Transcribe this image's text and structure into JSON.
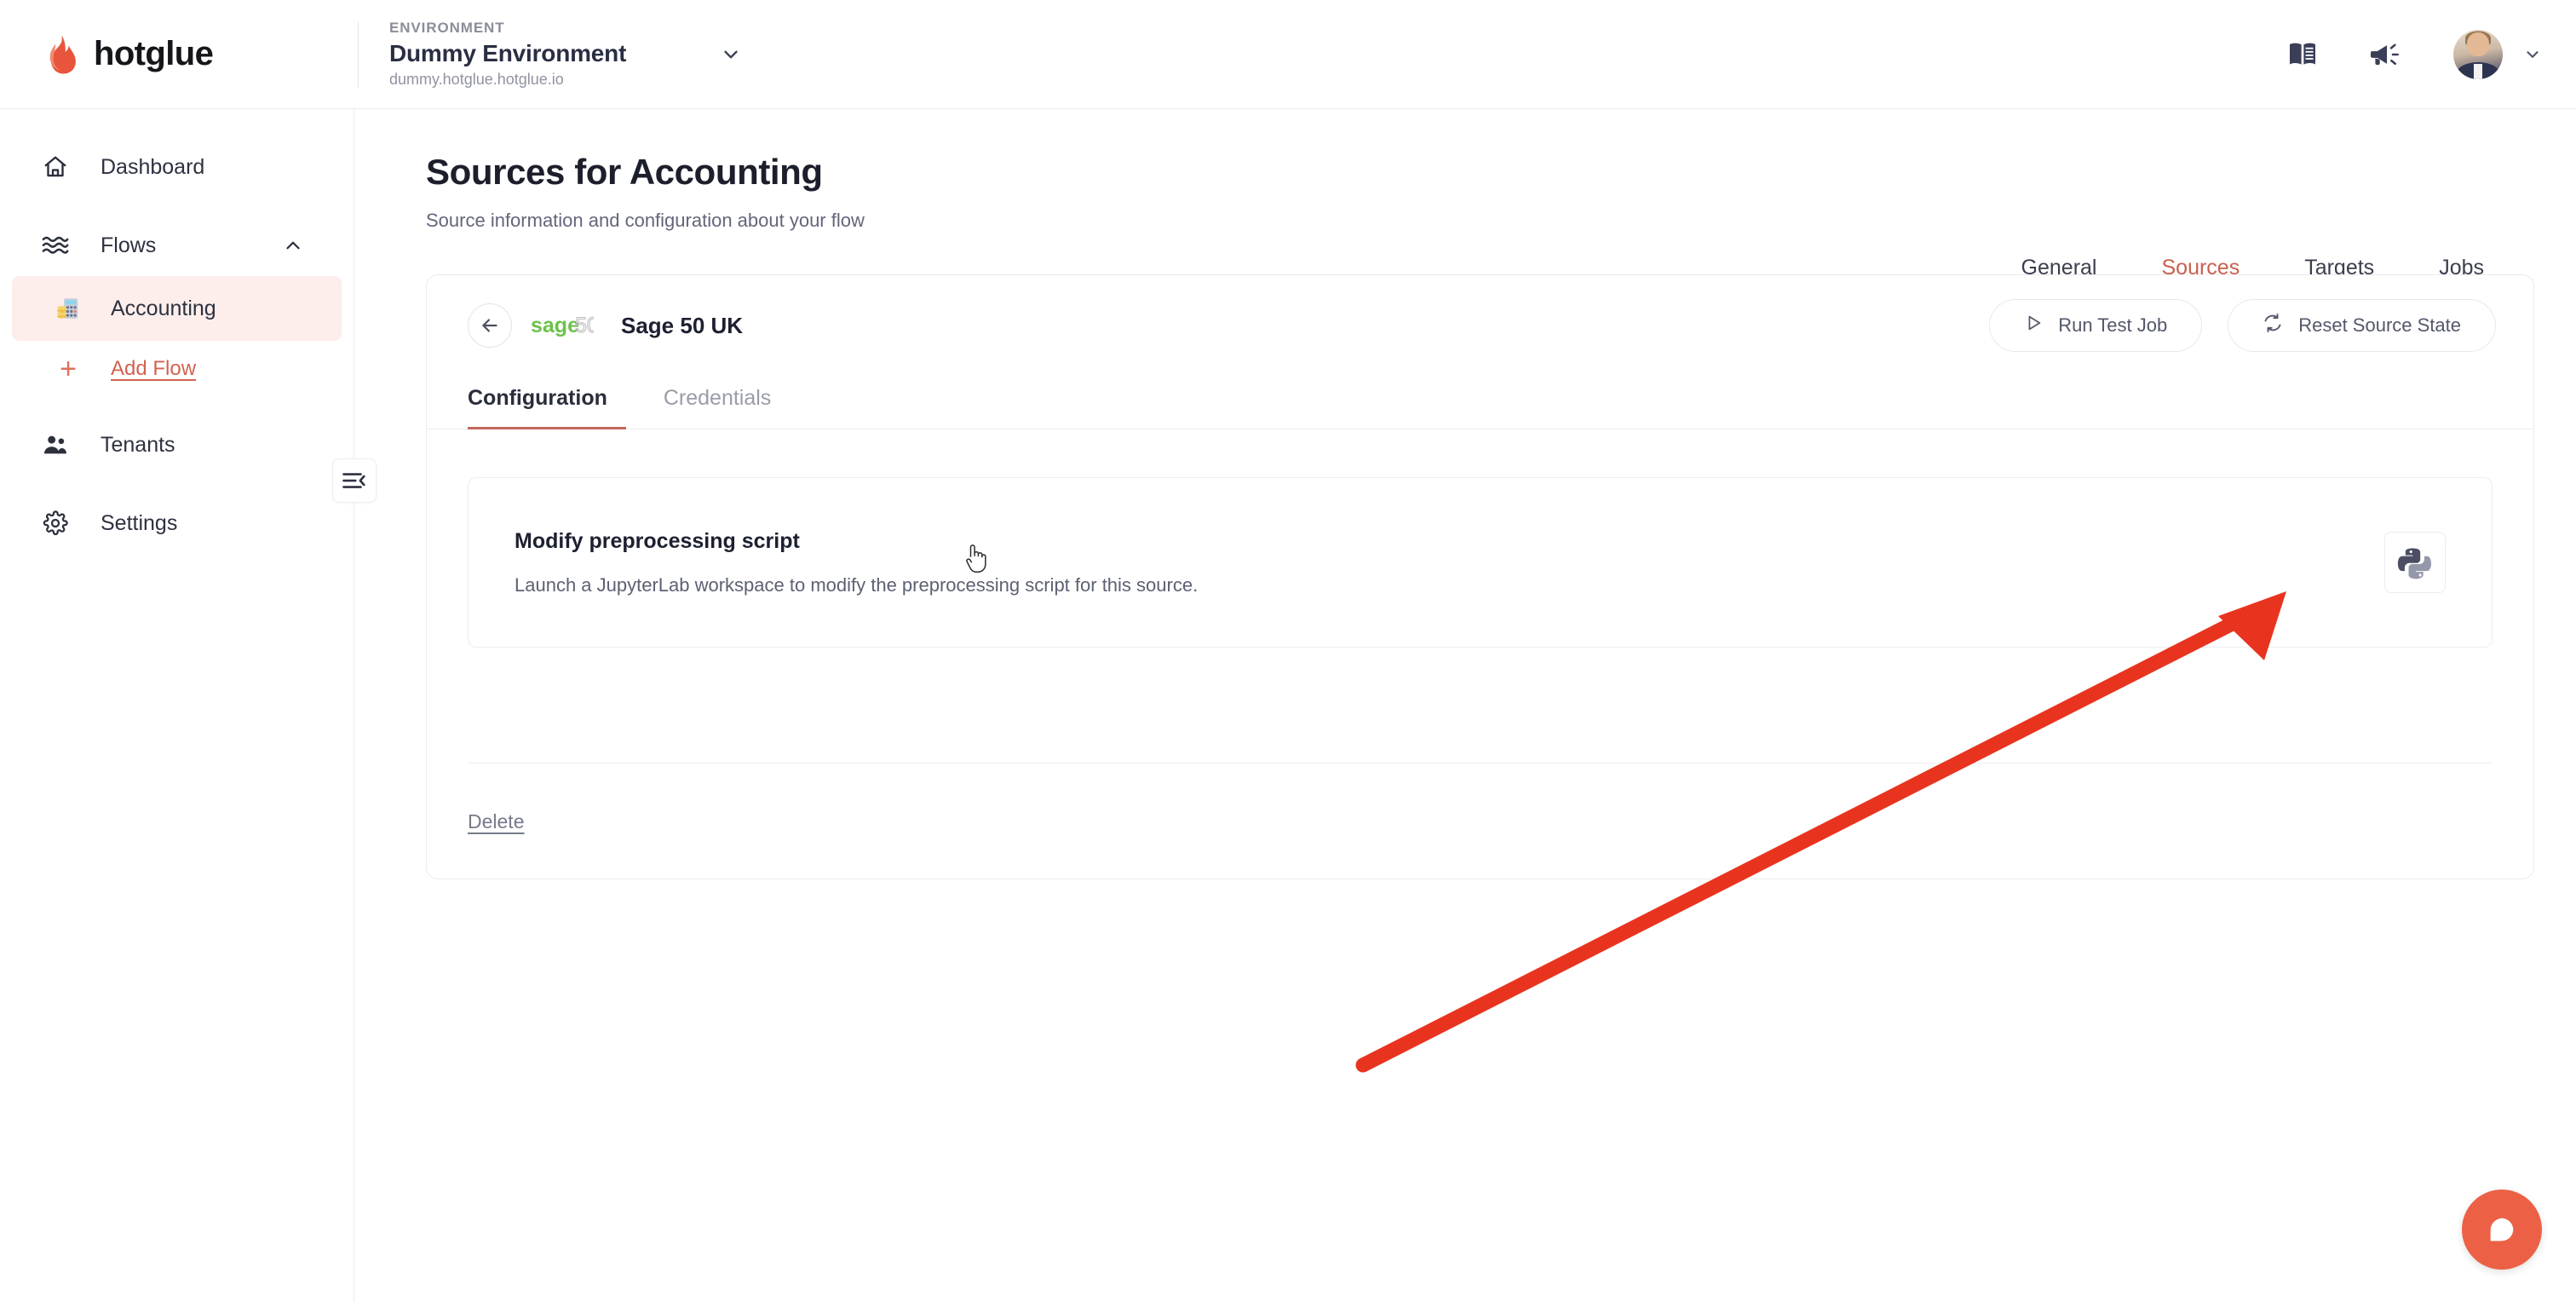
{
  "topbar": {
    "brand_name": "hotglue",
    "logo_icon": "flame-icon",
    "environment": {
      "label": "ENVIRONMENT",
      "name": "Dummy Environment",
      "url": "dummy.hotglue.hotglue.io",
      "caret_icon": "chevron-down-icon"
    },
    "docs_icon": "book-icon",
    "announcements_icon": "megaphone-icon",
    "avatar_icon": "user-avatar",
    "user_caret_icon": "chevron-down-icon"
  },
  "sidebar": {
    "collapse_icon": "collapse-sidebar-icon",
    "items": [
      {
        "label": "Dashboard",
        "icon": "home-icon"
      },
      {
        "label": "Flows",
        "icon": "flows-icon",
        "chevron": "chevron-up-icon"
      },
      {
        "label": "Accounting",
        "icon": "abacus-icon",
        "active": true
      },
      {
        "label": "Add Flow",
        "icon": "plus-icon"
      },
      {
        "label": "Tenants",
        "icon": "people-icon"
      },
      {
        "label": "Settings",
        "icon": "gear-icon"
      }
    ]
  },
  "page": {
    "title": "Sources for Accounting",
    "subtitle": "Source information and configuration about your flow",
    "tabs": [
      {
        "label": "General"
      },
      {
        "label": "Sources",
        "active": true
      },
      {
        "label": "Targets"
      },
      {
        "label": "Jobs"
      }
    ]
  },
  "card": {
    "back_icon": "arrow-left-icon",
    "logo_text_primary": "sage",
    "logo_text_secondary": "50",
    "source_name": "Sage 50 UK",
    "actions": [
      {
        "label": "Run Test Job",
        "icon": "play-icon"
      },
      {
        "label": "Reset Source State",
        "icon": "refresh-icon"
      }
    ],
    "tabs": [
      {
        "label": "Configuration",
        "active": true
      },
      {
        "label": "Credentials"
      }
    ],
    "panel": {
      "title": "Modify preprocessing script",
      "description": "Launch a JupyterLab workspace to modify the preprocessing script for this source.",
      "action_icon": "python-icon"
    },
    "delete_label": "Delete"
  },
  "chat": {
    "icon": "chat-bubble-icon"
  },
  "annotation": {
    "arrow_icon": "red-arrow-annotation"
  },
  "cursor": {
    "icon": "pointer-hand-cursor"
  },
  "colors": {
    "accent": "#c9604f",
    "accent_soft": "#fdeeeb",
    "brand_flame": "#ec6145",
    "sage_green": "#6cc24a",
    "annotation_red": "#e8341f",
    "chat_orange": "#ec6145",
    "text_primary": "#1d2030",
    "text_muted": "#63667a"
  }
}
